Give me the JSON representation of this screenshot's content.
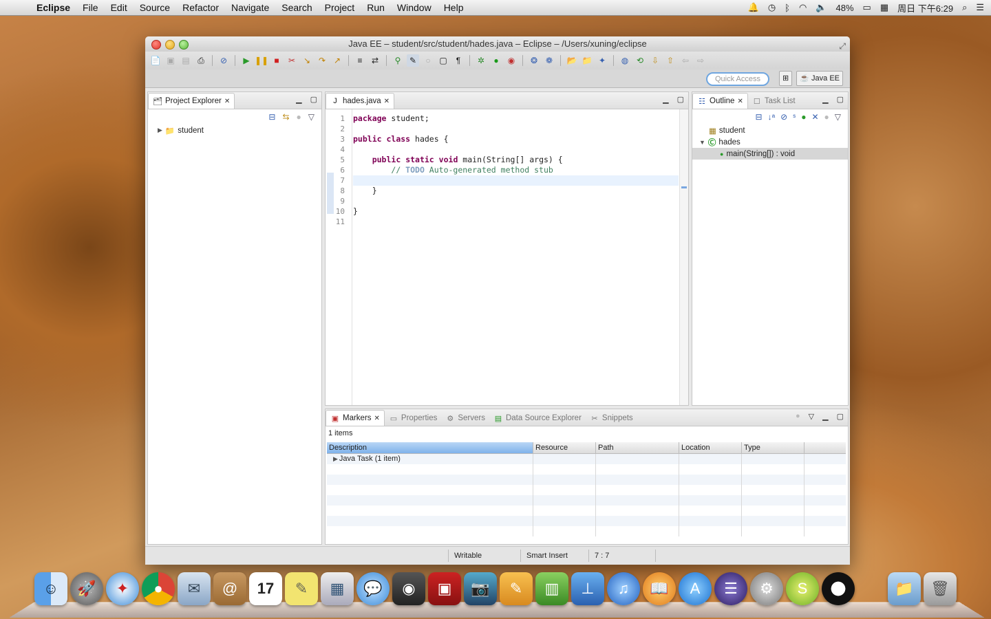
{
  "menubar": {
    "app": "Eclipse",
    "items": [
      "File",
      "Edit",
      "Source",
      "Refactor",
      "Navigate",
      "Search",
      "Project",
      "Run",
      "Window",
      "Help"
    ],
    "battery": "48%",
    "clock": "周日 下午6:29"
  },
  "window": {
    "title": "Java EE – student/src/student/hades.java – Eclipse – /Users/xuning/eclipse"
  },
  "toolbar2": {
    "quick_access": "Quick Access",
    "perspective": "Java EE"
  },
  "project_explorer": {
    "tab": "Project Explorer",
    "tree": [
      {
        "label": "student"
      }
    ]
  },
  "editor": {
    "tab": "hades.java",
    "line_numbers": [
      "1",
      "2",
      "3",
      "4",
      "5",
      "6",
      "7",
      "8",
      "9",
      "10",
      "11"
    ]
  },
  "outline": {
    "tabs": [
      "Outline",
      "Task List"
    ],
    "items": [
      "student",
      "hades",
      "main(String[]) : void"
    ]
  },
  "markers": {
    "tabs": [
      "Markers",
      "Properties",
      "Servers",
      "Data Source Explorer",
      "Snippets"
    ],
    "count": "1 items",
    "columns": [
      "Description",
      "Resource",
      "Path",
      "Location",
      "Type"
    ],
    "rows": [
      {
        "description": "Java Task (1 item)"
      }
    ]
  },
  "status": {
    "mode": "Writable",
    "insert": "Smart Insert",
    "position": "7 : 7"
  }
}
